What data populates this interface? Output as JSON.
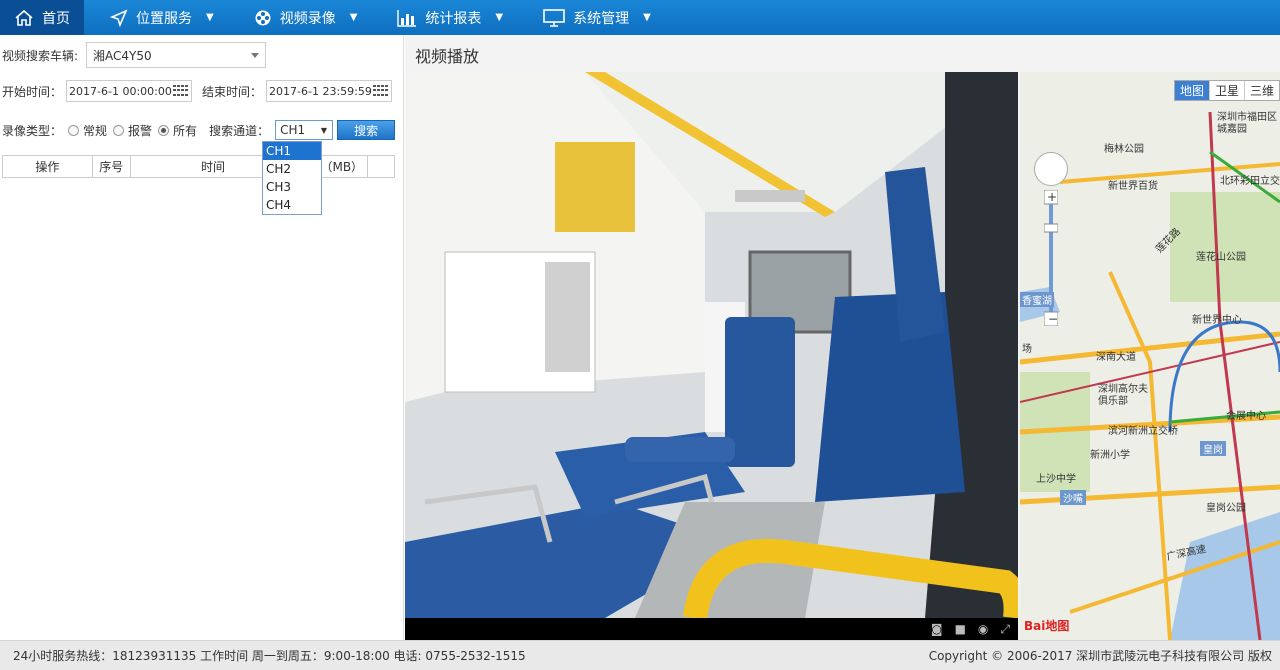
{
  "nav": {
    "home": "首页",
    "location": "位置服务",
    "video": "视频录像",
    "stats": "统计报表",
    "system": "系统管理"
  },
  "search": {
    "vehicle_label": "视频搜索车辆:",
    "vehicle_value": "湘AC4Y50",
    "start_label": "开始时间：",
    "start_value": "2017-6-1 00:00:00",
    "end_label": "结束时间：",
    "end_value": "2017-6-1 23:59:59",
    "type_label": "录像类型：",
    "type_normal": "常规",
    "type_alarm": "报警",
    "type_all": "所有",
    "channel_label": "搜索通道：",
    "channel_value": "CH1",
    "search_button": "搜索",
    "channel_options": [
      "CH1",
      "CH2",
      "CH3",
      "CH4"
    ]
  },
  "table": {
    "col_op": "操作",
    "col_seq": "序号",
    "col_time": "时间",
    "col_size": "（MB）"
  },
  "video": {
    "title": "视频播放"
  },
  "map": {
    "tab_map": "地图",
    "tab_sat": "卫星",
    "tab_3d": "三维",
    "labels": [
      "深圳市福田区",
      "城嘉园",
      "梅林公园",
      "新世界百货",
      "北环彩田立交",
      "莲花路",
      "莲花山公园",
      "香蜜湖",
      "新世界中心",
      "深南大道",
      "深圳高尔夫",
      "俱乐部",
      "会展中心",
      "滨河新洲立交桥",
      "新洲小学",
      "皇岗",
      "上沙中学",
      "沙嘴",
      "皇岗公园",
      "广深高速",
      "场"
    ],
    "logo": "Bai地图"
  },
  "footer": {
    "left": "24小时服务热线：18123931135  工作时间 周一到周五：9:00-18:00  电话: 0755-2532-1515",
    "right": "Copyright © 2006-2017 深圳市武陵沅电子科技有限公司 版权"
  }
}
